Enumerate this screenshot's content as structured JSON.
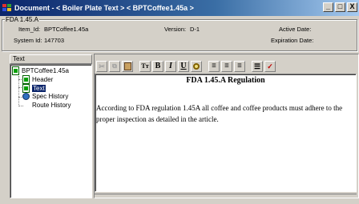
{
  "window": {
    "title": "Document - < Boiler Plate Text > < BPTCoffee1.45a >",
    "controls": {
      "minimize": "_",
      "maximize": "□",
      "close": "X"
    }
  },
  "header": {
    "group_label": "FDA 1.45.A",
    "item_id_label": "Item_Id:",
    "item_id_value": "BPTCoffee1.45a",
    "system_id_label": "System Id:",
    "system_id_value": "147703",
    "version_label": "Version:",
    "version_value": "D-1",
    "active_date_label": "Active Date:",
    "expiration_date_label": "Expiration Date:"
  },
  "left_panel": {
    "label": "Text",
    "tree": {
      "root": "BPTCoffee1.45a",
      "children": [
        "Header",
        "Text",
        "Spec History",
        "Route History"
      ],
      "selected": "Text"
    }
  },
  "toolbar": {
    "buttons": [
      "cut",
      "copy",
      "paste",
      "font",
      "bold",
      "italic",
      "underline",
      "find",
      "align-left",
      "align-center",
      "align-right",
      "bullets",
      "spell-check"
    ],
    "labels": {
      "font": "Tт",
      "bold": "B",
      "italic": "I",
      "underline": "U"
    }
  },
  "document": {
    "title": "FDA 1.45.A Regulation",
    "body": "According to FDA regulation 1.45A all coffee and coffee products must adhere to the proper inspection as detailed in the article."
  },
  "colors": {
    "titlebar_start": "#0a246a",
    "titlebar_end": "#a6caf0",
    "selection": "#0a246a"
  }
}
